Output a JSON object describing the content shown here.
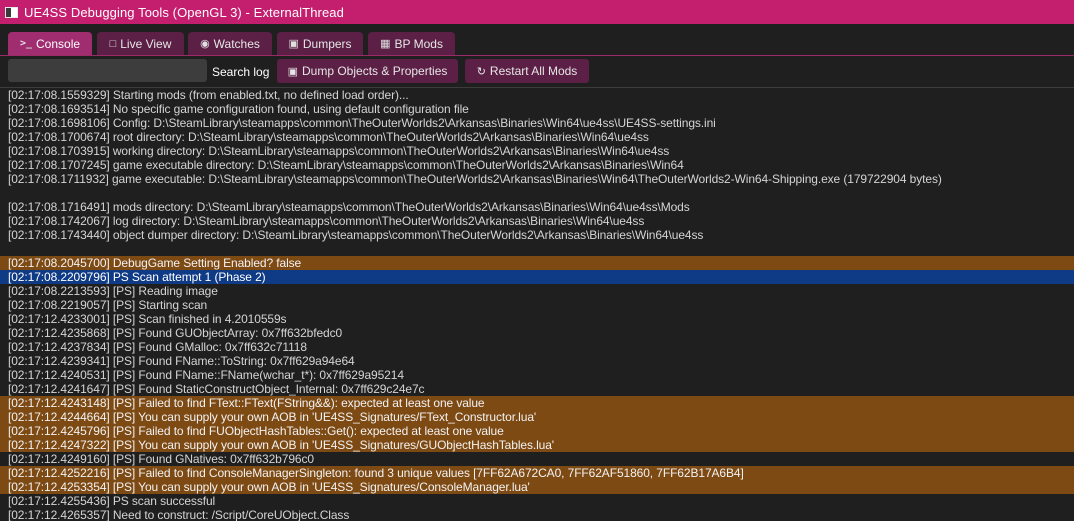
{
  "window": {
    "title": "UE4SS Debugging Tools (OpenGL 3) - ExternalThread"
  },
  "tabs": [
    {
      "label": "Console",
      "icon": "terminal-icon",
      "active": true
    },
    {
      "label": "Live View",
      "icon": "document-icon",
      "active": false
    },
    {
      "label": "Watches",
      "icon": "eye-icon",
      "active": false
    },
    {
      "label": "Dumpers",
      "icon": "box-icon",
      "active": false
    },
    {
      "label": "BP Mods",
      "icon": "puzzle-icon",
      "active": false
    }
  ],
  "toolbar": {
    "search_value": "",
    "search_label": "Search log",
    "dump_button": "Dump Objects & Properties",
    "restart_button": "Restart All Mods"
  },
  "colors": {
    "title_bar": "#c41e6e",
    "tab_active": "#a02d6f",
    "tab_inactive": "#5c1f46",
    "warning_row": "#7e4a14",
    "selected_row": "#0e3a86"
  },
  "log": [
    {
      "text": "[02:17:08.1559329] Starting mods (from enabled.txt, no defined load order)...",
      "level": "normal"
    },
    {
      "text": "[02:17:08.1693514] No specific game configuration found, using default configuration file",
      "level": "normal"
    },
    {
      "text": "[02:17:08.1698106] Config: D:\\SteamLibrary\\steamapps\\common\\TheOuterWorlds2\\Arkansas\\Binaries\\Win64\\ue4ss\\UE4SS-settings.ini",
      "level": "normal"
    },
    {
      "text": "[02:17:08.1700674] root directory: D:\\SteamLibrary\\steamapps\\common\\TheOuterWorlds2\\Arkansas\\Binaries\\Win64\\ue4ss",
      "level": "normal"
    },
    {
      "text": "[02:17:08.1703915] working directory: D:\\SteamLibrary\\steamapps\\common\\TheOuterWorlds2\\Arkansas\\Binaries\\Win64\\ue4ss",
      "level": "normal"
    },
    {
      "text": "[02:17:08.1707245] game executable directory: D:\\SteamLibrary\\steamapps\\common\\TheOuterWorlds2\\Arkansas\\Binaries\\Win64",
      "level": "normal"
    },
    {
      "text": "[02:17:08.1711932] game executable: D:\\SteamLibrary\\steamapps\\common\\TheOuterWorlds2\\Arkansas\\Binaries\\Win64\\TheOuterWorlds2-Win64-Shipping.exe (179722904 bytes)",
      "level": "normal"
    },
    {
      "text": "",
      "level": "normal"
    },
    {
      "text": "[02:17:08.1716491] mods directory: D:\\SteamLibrary\\steamapps\\common\\TheOuterWorlds2\\Arkansas\\Binaries\\Win64\\ue4ss\\Mods",
      "level": "normal"
    },
    {
      "text": "[02:17:08.1742067] log directory: D:\\SteamLibrary\\steamapps\\common\\TheOuterWorlds2\\Arkansas\\Binaries\\Win64\\ue4ss",
      "level": "normal"
    },
    {
      "text": "[02:17:08.1743440] object dumper directory: D:\\SteamLibrary\\steamapps\\common\\TheOuterWorlds2\\Arkansas\\Binaries\\Win64\\ue4ss",
      "level": "normal"
    },
    {
      "text": "",
      "level": "normal"
    },
    {
      "text": "[02:17:08.2045700] DebugGame Setting Enabled? false",
      "level": "warning"
    },
    {
      "text": "[02:17:08.2209796] PS Scan attempt 1 (Phase 2)",
      "level": "selected"
    },
    {
      "text": "[02:17:08.2213593] [PS] Reading image",
      "level": "normal"
    },
    {
      "text": "[02:17:08.2219057] [PS] Starting scan",
      "level": "normal"
    },
    {
      "text": "[02:17:12.4233001] [PS] Scan finished in 4.2010559s",
      "level": "normal"
    },
    {
      "text": "[02:17:12.4235868] [PS] Found GUObjectArray: 0x7ff632bfedc0",
      "level": "normal"
    },
    {
      "text": "[02:17:12.4237834] [PS] Found GMalloc: 0x7ff632c71118",
      "level": "normal"
    },
    {
      "text": "[02:17:12.4239341] [PS] Found FName::ToString: 0x7ff629a94e64",
      "level": "normal"
    },
    {
      "text": "[02:17:12.4240531] [PS] Found FName::FName(wchar_t*): 0x7ff629a95214",
      "level": "normal"
    },
    {
      "text": "[02:17:12.4241647] [PS] Found StaticConstructObject_Internal: 0x7ff629c24e7c",
      "level": "normal"
    },
    {
      "text": "[02:17:12.4243148] [PS] Failed to find FText::FText(FString&&): expected at least one value",
      "level": "warning"
    },
    {
      "text": "[02:17:12.4244664] [PS] You can supply your own AOB in 'UE4SS_Signatures/FText_Constructor.lua'",
      "level": "warning"
    },
    {
      "text": "[02:17:12.4245796] [PS] Failed to find FUObjectHashTables::Get(): expected at least one value",
      "level": "warning"
    },
    {
      "text": "[02:17:12.4247322] [PS] You can supply your own AOB in 'UE4SS_Signatures/GUObjectHashTables.lua'",
      "level": "warning"
    },
    {
      "text": "[02:17:12.4249160] [PS] Found GNatives: 0x7ff632b796c0",
      "level": "normal"
    },
    {
      "text": "[02:17:12.4252216] [PS] Failed to find ConsoleManagerSingleton: found 3 unique values [7FF62A672CA0, 7FF62AF51860, 7FF62B17A6B4]",
      "level": "warning"
    },
    {
      "text": "[02:17:12.4253354] [PS] You can supply your own AOB in 'UE4SS_Signatures/ConsoleManager.lua'",
      "level": "warning"
    },
    {
      "text": "[02:17:12.4255436] PS scan successful",
      "level": "normal"
    },
    {
      "text": "[02:17:12.4265357] Need to construct: /Script/CoreUObject.Class",
      "level": "normal"
    }
  ]
}
